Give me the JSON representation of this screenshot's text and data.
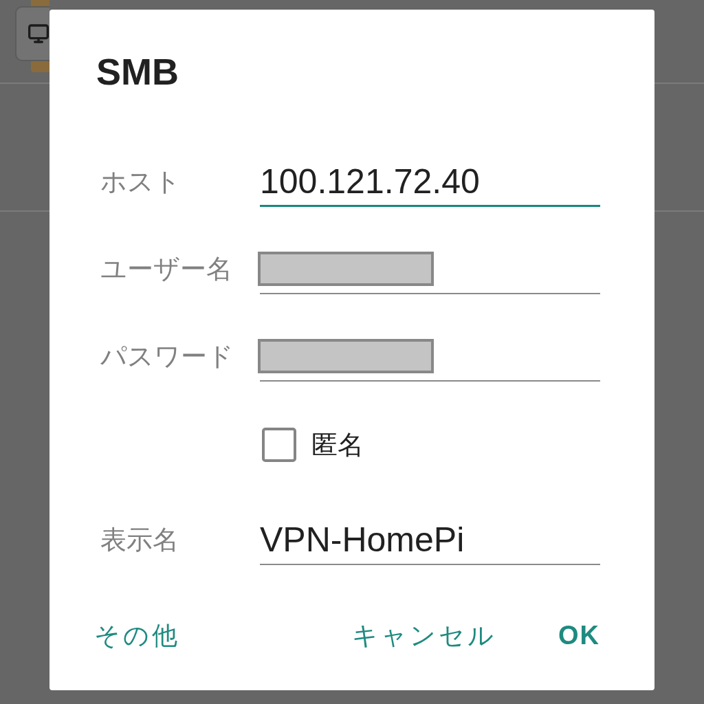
{
  "dialog": {
    "title": "SMB",
    "rows": [
      {
        "kind": "field",
        "label": "ホスト",
        "value": "100.121.72.40",
        "focused": true
      },
      {
        "kind": "field",
        "label": "ユーザー名",
        "focused": false,
        "redacted": true
      },
      {
        "kind": "field",
        "label": "パスワード",
        "focused": false,
        "redacted": true
      },
      {
        "kind": "checkbox",
        "label": "匿名",
        "checked": false
      },
      {
        "kind": "field",
        "label": "表示名",
        "value": "VPN-HomePi",
        "focused": false
      }
    ],
    "buttons": [
      {
        "label": "その他",
        "kind": "neutral"
      },
      {
        "label": "キャンセル",
        "kind": "negative"
      },
      {
        "label": "OK",
        "kind": "positive"
      }
    ]
  }
}
